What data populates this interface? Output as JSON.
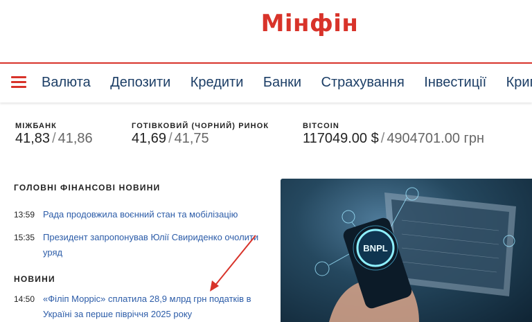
{
  "header": {
    "logo_text": "Мінфін"
  },
  "nav": {
    "items": [
      "Валюта",
      "Депозити",
      "Кредити",
      "Банки",
      "Страхування",
      "Інвестиції",
      "Криптовалюта"
    ]
  },
  "rates": [
    {
      "label": "МІЖБАНК",
      "buy": "41,83",
      "sell": "41,86",
      "sep": "/"
    },
    {
      "label": "ГОТІВКОВИЙ (ЧОРНИЙ) РИНОК",
      "buy": "41,69",
      "sell": "41,75",
      "sep": "/"
    },
    {
      "label": "BITCOIN",
      "buy": "117049.00 $",
      "sell": "4904701.00 грн",
      "sep": "/"
    }
  ],
  "main_news": {
    "title": "ГОЛОВНІ ФІНАНСОВІ НОВИНИ",
    "items": [
      {
        "time": "13:59",
        "text": "Рада продовжила воєнний стан та мобілізацію"
      },
      {
        "time": "15:35",
        "text": "Президент запропонував Юлії Свириденко очолити уряд"
      }
    ]
  },
  "news": {
    "title": "НОВИНИ",
    "items": [
      {
        "time": "14:50",
        "text": "«Філіп Морріс» сплатила 28,9 млрд грн податків в Україні за перше півріччя 2025 року"
      }
    ]
  },
  "hero": {
    "badge": "BNPL"
  },
  "colors": {
    "brand": "#d8332a",
    "nav_text": "#1c3e66",
    "link": "#2c5ca8"
  }
}
